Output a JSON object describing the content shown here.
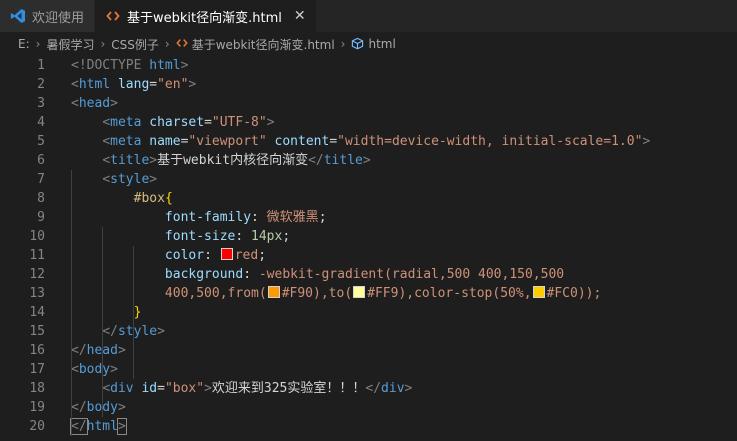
{
  "tabs": [
    {
      "label": "欢迎使用",
      "icon": "vscode-logo-icon",
      "active": false
    },
    {
      "label": "基于webkit径向渐变.html",
      "icon": "html-file-icon",
      "active": true
    }
  ],
  "breadcrumb": [
    "E:",
    "暑假学习",
    "CSS例子",
    "基于webkit径向渐变.html",
    "html"
  ],
  "colors": {
    "background": "#1e1e1e",
    "tag": "#569cd6",
    "attr": "#9cdcfe",
    "string": "#ce9178"
  },
  "lines": [
    "1",
    "2",
    "3",
    "4",
    "5",
    "6",
    "7",
    "8",
    "9",
    "10",
    "11",
    "12",
    "13",
    "14",
    "15",
    "16",
    "17",
    "18",
    "19",
    "20"
  ],
  "code": {
    "doctype_kw": "<!DOCTYPE ",
    "doctype_html": "html",
    "doctype_end": ">",
    "html_tag": "html",
    "lang_attr": "lang",
    "lang_val": "\"en\"",
    "head_tag": "head",
    "meta_tag": "meta",
    "charset_attr": "charset",
    "charset_val": "\"UTF-8\"",
    "name_attr": "name",
    "name_val": "\"viewport\"",
    "content_attr": "content",
    "content_val": "\"width=device-width, initial-scale=1.0\"",
    "title_tag": "title",
    "title_text": "基于webkit内核径向渐变",
    "style_tag": "style",
    "selector": "#box",
    "brace_open": "{",
    "brace_close": "}",
    "prop_font_family": "font-family",
    "val_font_family": "微软雅黑",
    "prop_font_size": "font-size",
    "val_font_size": "14px",
    "prop_color": "color",
    "val_color": "red",
    "prop_background": "background",
    "val_bg_fn": "-webkit-gradient",
    "val_bg_line1": "(radial,500 400,150,500",
    "val_bg_line2a": "400,500,",
    "fn_from": "from",
    "val_f90": "#F90",
    "fn_to": "to",
    "val_ff9": "#FF9",
    "fn_color_stop": "color-stop",
    "val_stop_pct": "50%,",
    "val_fc0": "#FC0",
    "body_tag": "body",
    "div_tag": "div",
    "id_attr": "id",
    "id_val": "\"box\"",
    "div_text": "欢迎来到325实验室！！！"
  },
  "swatches": {
    "red": "#ff0000",
    "f90": "#ff9900",
    "ff9": "#ffff99",
    "fc0": "#ffcc00"
  }
}
